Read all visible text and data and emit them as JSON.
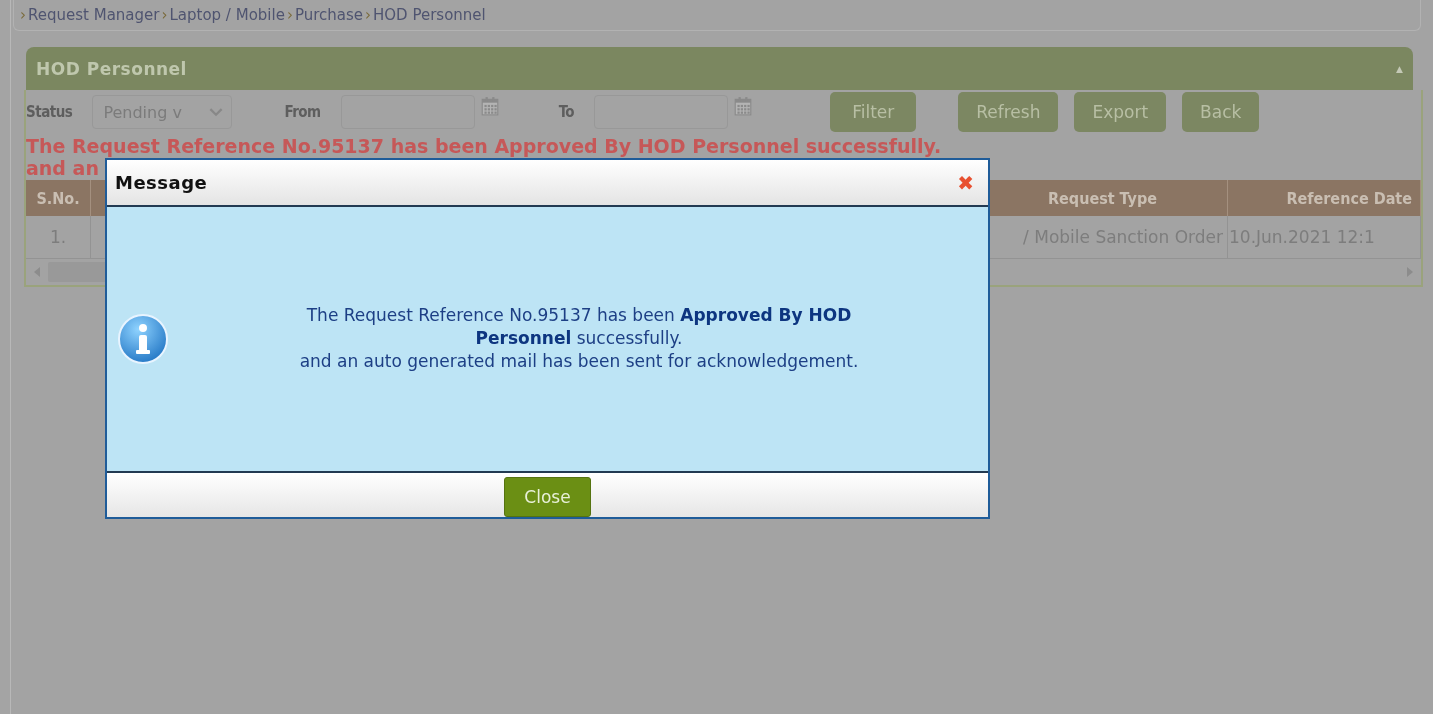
{
  "breadcrumb": {
    "separator": "›",
    "items": [
      "Request Manager",
      "Laptop / Mobile",
      "Purchase",
      "HOD Personnel"
    ]
  },
  "panel": {
    "title": "HOD Personnel",
    "collapse_glyph": "▲"
  },
  "filters": {
    "status_label": "Status",
    "status_value": "Pending v",
    "from_label": "From",
    "to_label": "To",
    "buttons": [
      "Filter",
      "Refresh",
      "Export",
      "Back"
    ]
  },
  "notice": [
    "The Request Reference No.95137 has been Approved By HOD Personnel successfully.",
    "and an"
  ],
  "table": {
    "columns": [
      "S.No.",
      "Request Type",
      "Reference Date"
    ],
    "rows": [
      [
        "1.",
        "/ Mobile Sanction Order",
        "10.Jun.2021 12:1"
      ]
    ]
  },
  "dialog": {
    "title": "Message",
    "close_glyph": "✖",
    "message": [
      "The Request Reference No.95137 has been **Approved By HOD Personnel** successfully.",
      "and an auto generated mail has been sent for acknowledgement."
    ],
    "button": "Close"
  }
}
